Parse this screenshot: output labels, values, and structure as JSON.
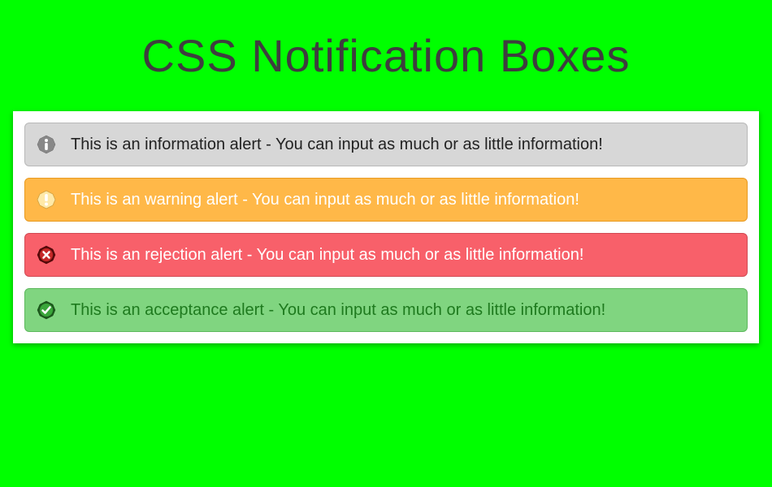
{
  "title": "CSS Notification Boxes",
  "alerts": [
    {
      "type": "info",
      "icon": "info-icon",
      "text": "This is an information alert - You can input as much or as little information!"
    },
    {
      "type": "warning",
      "icon": "warning-icon",
      "text": "This is an warning alert - You can input as much or as little information!"
    },
    {
      "type": "error",
      "icon": "error-icon",
      "text": "This is an rejection alert - You can input as much or as little information!"
    },
    {
      "type": "success",
      "icon": "success-icon",
      "text": "This is an acceptance alert - You can input as much or as little information!"
    }
  ],
  "colors": {
    "background": "#00ff00",
    "info_bg": "#d7d7d7",
    "warning_bg": "#ffb848",
    "error_bg": "#f8606a",
    "success_bg": "#80d580"
  }
}
